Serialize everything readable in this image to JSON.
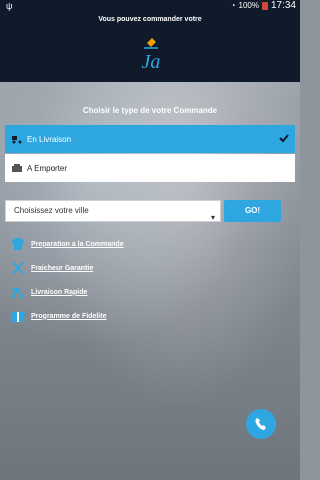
{
  "status_bar": {
    "battery": "100%",
    "time": "17:34",
    "left_icon": "usb-icon"
  },
  "header": {
    "hint": "Vous pouvez commander votre",
    "logo_text": "Ja"
  },
  "order": {
    "title": "Choisir le type de votre Commande",
    "options": [
      {
        "label": "En Livraison",
        "selected": true
      },
      {
        "label": "A Emporter",
        "selected": false
      }
    ]
  },
  "city": {
    "placeholder": "Choisissez votre ville",
    "go_label": "GO!"
  },
  "features": [
    {
      "label": "Preparation a la Commande",
      "icon": "chef-hat-icon"
    },
    {
      "label": "Fraicheur Garantie",
      "icon": "utensils-icon"
    },
    {
      "label": "Livraison Rapide",
      "icon": "scooter-icon"
    },
    {
      "label": "Programme de Fidelite",
      "icon": "gift-icon"
    }
  ],
  "colors": {
    "accent": "#2ea7e0",
    "header_bg": "#0f1a2b"
  }
}
